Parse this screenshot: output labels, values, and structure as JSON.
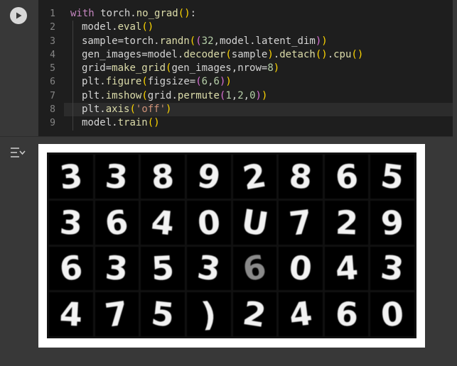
{
  "code_cell": {
    "line_numbers": [
      "1",
      "2",
      "3",
      "4",
      "5",
      "6",
      "7",
      "8",
      "9"
    ],
    "lines": [
      [
        "with torch.no_grad():"
      ],
      [
        "model.eval()"
      ],
      [
        "sample=torch.randn((32,model.latent_dim))"
      ],
      [
        "gen_images=model.decoder(sample).detach().cpu()"
      ],
      [
        "grid=make_grid(gen_images,nrow=8)"
      ],
      [
        "plt.figure(figsize=(6,6))"
      ],
      [
        "plt.imshow(grid.permute(1,2,0))"
      ],
      [
        "plt.axis('off')"
      ],
      [
        "model.train()"
      ]
    ],
    "active_line": 8,
    "run_icon": "play-icon"
  },
  "output": {
    "toggle_icon": "output-toggle-icon",
    "digits": [
      [
        "3",
        "3",
        "8",
        "9",
        "2",
        "8",
        "6",
        "5"
      ],
      [
        "3",
        "6",
        "4",
        "0",
        "U",
        "7",
        "2",
        "9"
      ],
      [
        "6",
        "3",
        "5",
        "3",
        "6",
        "0",
        "4",
        "3"
      ],
      [
        "4",
        "7",
        "5",
        ")",
        "2",
        "4",
        "6",
        "0"
      ]
    ]
  },
  "colors": {
    "editor_bg": "#1e1e1e",
    "cell_bg": "#383838",
    "keyword": "#c586c0",
    "function": "#dcdcaa",
    "number": "#b5cea8",
    "string": "#ce9178"
  }
}
